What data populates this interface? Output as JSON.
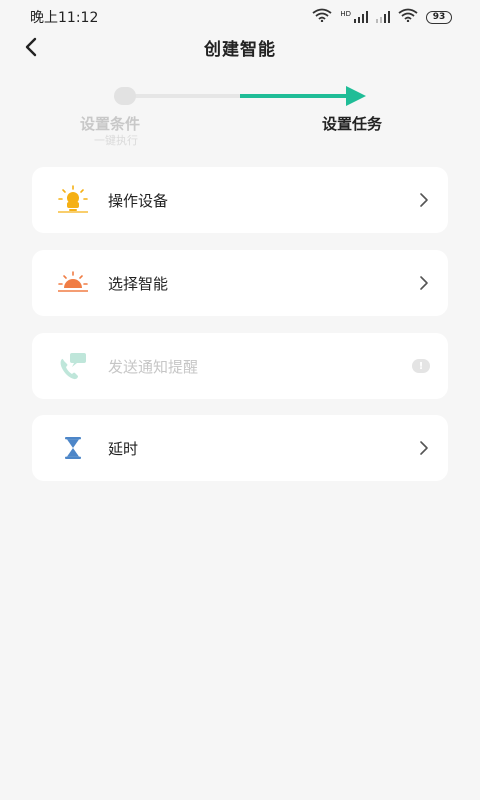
{
  "status_bar": {
    "time": "晚上11:12",
    "hd_label": "HD",
    "battery_level": "93",
    "icons": [
      "wifi-icon",
      "signal-icon",
      "signal-icon",
      "wifi-icon",
      "battery-icon"
    ]
  },
  "header": {
    "title": "创建智能",
    "back_icon": "chevron-left-icon"
  },
  "stepper": {
    "step1": {
      "label": "设置条件",
      "sublabel": "一键执行",
      "state": "done"
    },
    "step2": {
      "label": "设置任务",
      "state": "active"
    },
    "colors": {
      "active": "#1fbd97",
      "inactive": "#e2e2e2"
    }
  },
  "tasks": [
    {
      "label": "操作设备",
      "icon": "bulb-icon",
      "icon_color": "#f5b014",
      "enabled": true
    },
    {
      "label": "选择智能",
      "icon": "sunrise-icon",
      "icon_color": "#f07d45",
      "enabled": true
    },
    {
      "label": "发送通知提醒",
      "icon": "phone-message-icon",
      "icon_color": "#bfe6da",
      "enabled": false,
      "badge": "!"
    },
    {
      "label": "延时",
      "icon": "hourglass-icon",
      "icon_color": "#4d86c8",
      "enabled": true
    }
  ]
}
